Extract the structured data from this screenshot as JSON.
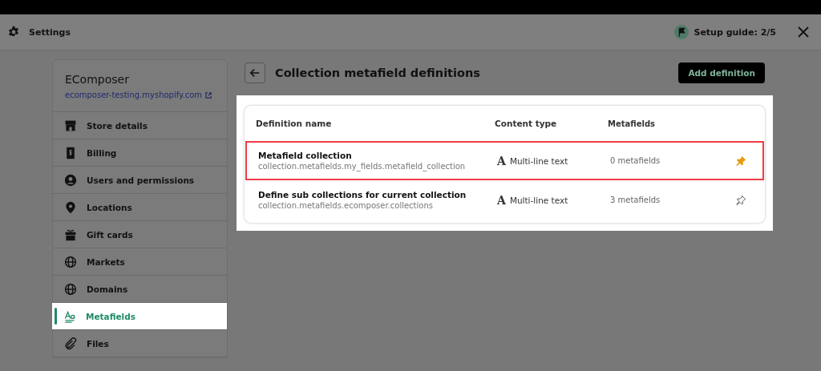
{
  "window": {
    "title": "Settings",
    "setup_guide": "Setup guide: 2/5"
  },
  "sidebar": {
    "store_name": "EComposer",
    "store_url": "ecomposer-testing.myshopify.com",
    "items": [
      {
        "label": "Store details",
        "selected": false
      },
      {
        "label": "Billing",
        "selected": false
      },
      {
        "label": "Users and permissions",
        "selected": false
      },
      {
        "label": "Locations",
        "selected": false
      },
      {
        "label": "Gift cards",
        "selected": false
      },
      {
        "label": "Markets",
        "selected": false
      },
      {
        "label": "Domains",
        "selected": false
      },
      {
        "label": "Metafields",
        "selected": true
      },
      {
        "label": "Files",
        "selected": false
      }
    ]
  },
  "page": {
    "title": "Collection metafield definitions",
    "add_button": "Add definition"
  },
  "table": {
    "columns": [
      "Definition name",
      "Content type",
      "Metafields"
    ],
    "rows": [
      {
        "name": "Metafield collection",
        "key": "collection.metafields.my_fields.metafield_collection",
        "content_type": "Multi-line text",
        "type_glyph": "A",
        "count": "0 metafields",
        "pinned": true,
        "highlighted": true
      },
      {
        "name": "Define sub collections for current collection",
        "key": "collection.metafields.ecomposer.collections",
        "content_type": "Multi-line text",
        "type_glyph": "A",
        "count": "3 metafields",
        "pinned": false,
        "highlighted": false
      }
    ]
  }
}
